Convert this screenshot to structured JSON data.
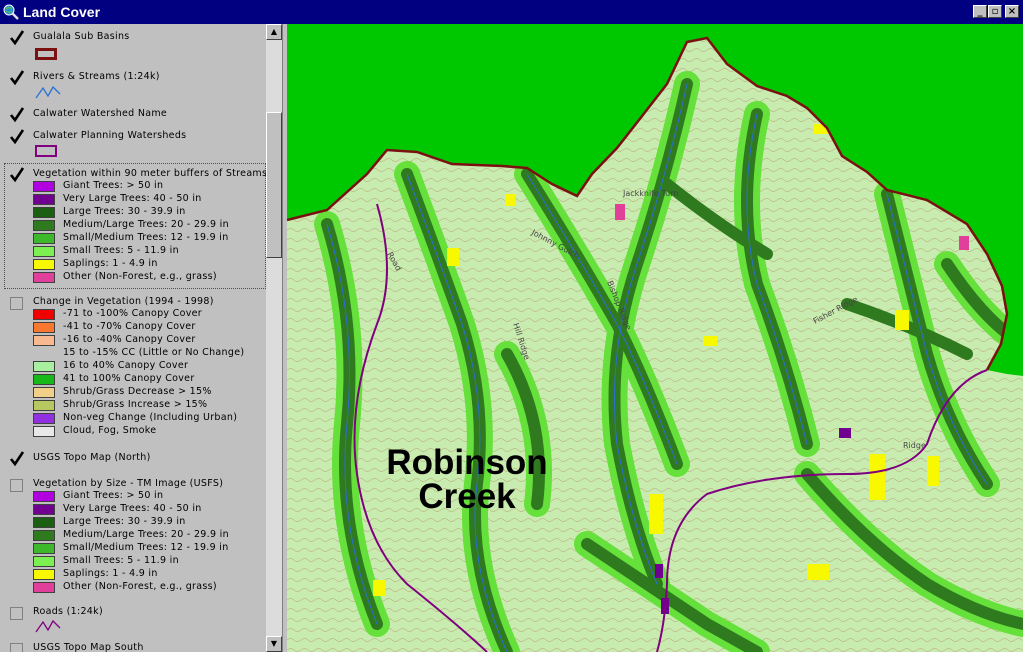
{
  "window": {
    "title": "Land Cover",
    "app_icon": "magnifier-globe-icon",
    "buttons": {
      "minimize": "_",
      "maximize": "▫",
      "close": "×"
    }
  },
  "colors": {
    "titlebar": "#000080",
    "map_background": "#00c800",
    "land": "#c8ecb0",
    "stream_buffer_dark": "#2f7a1e",
    "stream_buffer_light": "#66e03a",
    "basin_boundary": "#7a1010",
    "planning_watershed": "#800080",
    "streams": "#2a6fd6"
  },
  "legend": {
    "layers": [
      {
        "name": "Gualala Sub Basins",
        "checked": true,
        "symbol": "dark-red-outline-box"
      },
      {
        "name": "Rivers & Streams (1:24k)",
        "checked": true,
        "symbol": "blue-line"
      },
      {
        "name": "Calwater Watershed Name",
        "checked": true
      },
      {
        "name": "Calwater Planning Watersheds",
        "checked": true,
        "symbol": "purple-outline-box"
      },
      {
        "name": "Vegetation within 90 meter buffers of Streams",
        "checked": true,
        "items": [
          {
            "label": "Giant Trees: > 50 in",
            "color": "#b000e0"
          },
          {
            "label": "Very Large Trees: 40 - 50 in",
            "color": "#700090"
          },
          {
            "label": "Large Trees: 30 - 39.9 in",
            "color": "#1c5e12"
          },
          {
            "label": "Medium/Large Trees: 20 - 29.9 in",
            "color": "#2f7a1e"
          },
          {
            "label": "Small/Medium Trees: 12 - 19.9 in",
            "color": "#3cb82a"
          },
          {
            "label": "Small Trees: 5 - 11.9 in",
            "color": "#7cf050"
          },
          {
            "label": "Saplings: 1 - 4.9 in",
            "color": "#f8f800"
          },
          {
            "label": "Other (Non-Forest, e.g., grass)",
            "color": "#e0409a"
          }
        ]
      },
      {
        "name": "Change in Vegetation (1994 - 1998)",
        "checked": false,
        "items": [
          {
            "label": "-71 to -100% Canopy Cover",
            "color": "#f00000"
          },
          {
            "label": "-41 to -70% Canopy Cover",
            "color": "#f87830"
          },
          {
            "label": "-16 to -40% Canopy Cover",
            "color": "#f8b890"
          },
          {
            "label": "15 to -15% CC (Little or No Change)",
            "color": "#c0c0c0",
            "no_swatch": true
          },
          {
            "label": "16 to 40% Canopy Cover",
            "color": "#a8f0a0"
          },
          {
            "label": "41 to 100% Canopy Cover",
            "color": "#18b818"
          },
          {
            "label": "Shrub/Grass Decrease > 15%",
            "color": "#f0d088"
          },
          {
            "label": "Shrub/Grass Increase > 15%",
            "color": "#b8c860"
          },
          {
            "label": "Non-veg Change (Including Urban)",
            "color": "#9030e0"
          },
          {
            "label": "Cloud, Fog, Smoke",
            "color": "#e8e8e8"
          }
        ]
      },
      {
        "name": "USGS Topo Map (North)",
        "checked": true
      },
      {
        "name": "Vegetation by Size - TM Image (USFS)",
        "checked": false,
        "items": [
          {
            "label": "Giant Trees: > 50 in",
            "color": "#b000e0"
          },
          {
            "label": "Very Large Trees: 40 - 50 in",
            "color": "#700090"
          },
          {
            "label": "Large Trees: 30 - 39.9 in",
            "color": "#1c5e12"
          },
          {
            "label": "Medium/Large Trees: 20 - 29.9 in",
            "color": "#2f7a1e"
          },
          {
            "label": "Small/Medium Trees: 12 - 19.9 in",
            "color": "#3cb82a"
          },
          {
            "label": "Small Trees: 5 - 11.9 in",
            "color": "#7cf050"
          },
          {
            "label": "Saplings: 1 - 4.9 in",
            "color": "#f8f800"
          },
          {
            "label": "Other (Non-Forest, e.g., grass)",
            "color": "#e0409a"
          }
        ]
      },
      {
        "name": "Roads (1:24k)",
        "checked": false,
        "symbol": "purple-line"
      },
      {
        "name": "USGS Topo Map South",
        "checked": false
      }
    ]
  },
  "scrollbar": {
    "up_arrow": "▲",
    "down_arrow": "▼"
  },
  "map": {
    "watershed_label_line1": "Robinson",
    "watershed_label_line2": "Creek",
    "topo_labels": [
      "Jackknife Turn",
      "Johnny Gulch",
      "Bishop Ridge",
      "Fisher Ridge",
      "Ridge",
      "Hill Ridge",
      "Road"
    ]
  }
}
